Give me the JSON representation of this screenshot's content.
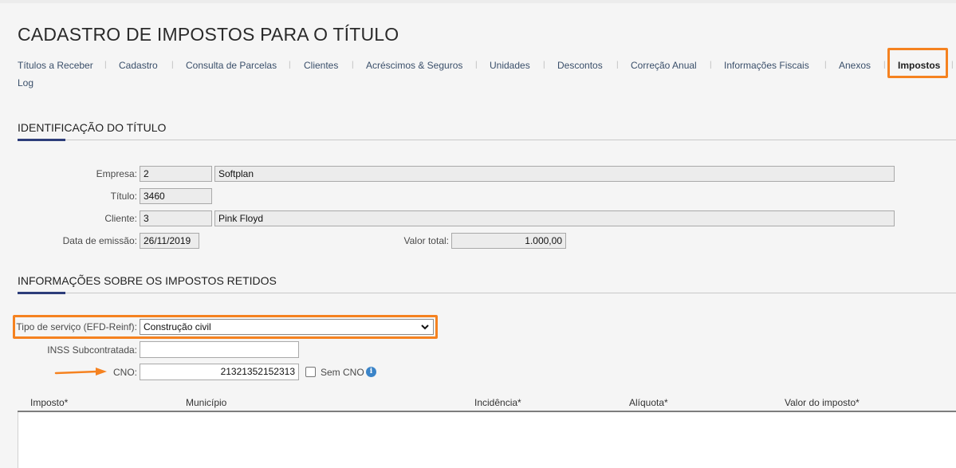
{
  "page_title": "CADASTRO DE IMPOSTOS PARA O TÍTULO",
  "tabs": [
    {
      "label": "Títulos a Receber"
    },
    {
      "label": "Cadastro"
    },
    {
      "label": "Consulta de Parcelas"
    },
    {
      "label": "Clientes"
    },
    {
      "label": "Acréscimos & Seguros"
    },
    {
      "label": "Unidades"
    },
    {
      "label": "Descontos"
    },
    {
      "label": "Correção Anual"
    },
    {
      "label": "Informações Fiscais"
    },
    {
      "label": "Anexos"
    },
    {
      "label": "Impostos",
      "active": true
    },
    {
      "label": "Log"
    }
  ],
  "tab_separator": "|",
  "identificacao": {
    "title": "IDENTIFICAÇÃO DO TÍTULO",
    "empresa_label": "Empresa:",
    "empresa_code": "2",
    "empresa_name": "Softplan",
    "titulo_label": "Título:",
    "titulo_value": "3460",
    "cliente_label": "Cliente:",
    "cliente_code": "3",
    "cliente_name": "Pink Floyd",
    "data_emissao_label": "Data de emissão:",
    "data_emissao_value": "26/11/2019",
    "valor_total_label": "Valor total:",
    "valor_total_value": "1.000,00"
  },
  "impostos_retidos": {
    "title": "INFORMAÇÕES SOBRE OS IMPOSTOS RETIDOS",
    "tipo_servico_label": "Tipo de serviço (EFD-Reinf):",
    "tipo_servico_value": "Construção civil",
    "inss_label": "INSS Subcontratada:",
    "inss_value": "",
    "cno_label": "CNO:",
    "cno_value": "21321352152313",
    "sem_cno_label": "Sem CNO",
    "sem_cno_checked": false
  },
  "table": {
    "columns": [
      "Imposto*",
      "Município",
      "Incidência*",
      "Alíquota*",
      "Valor do imposto*"
    ],
    "rows": []
  },
  "colors": {
    "highlight": "#f58220",
    "accent": "#2d3d7a",
    "info_icon": "#3b84c8",
    "arrow": "#f58220"
  },
  "icons": {
    "select_arrow": "chevron-down-icon",
    "info": "info-icon",
    "pointer": "arrow-right-icon"
  }
}
